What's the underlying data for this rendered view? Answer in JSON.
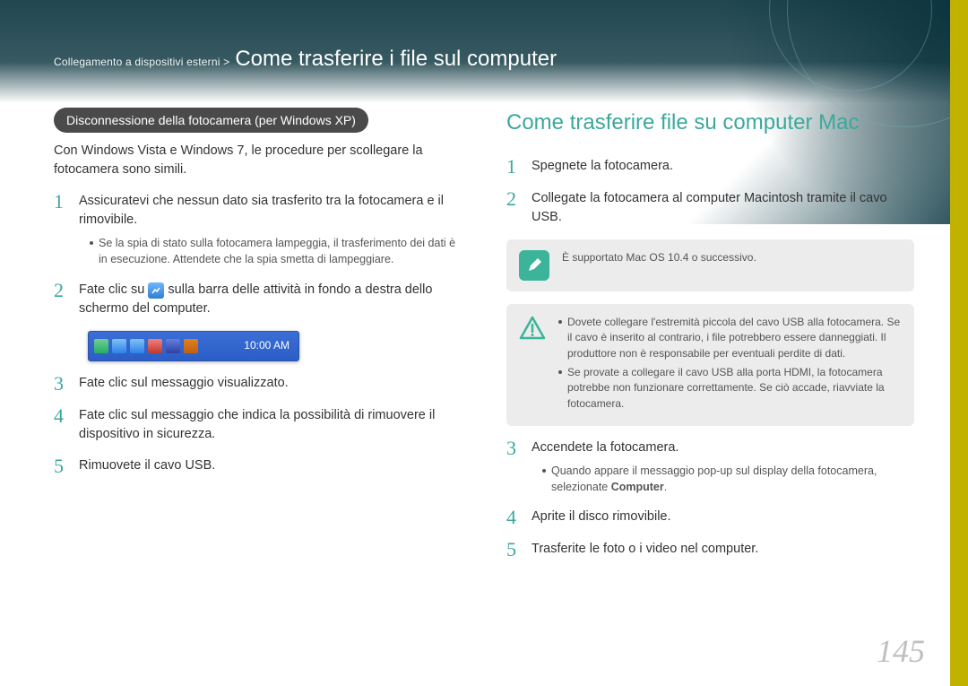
{
  "header": {
    "breadcrumb": "Collegamento a dispositivi esterni >",
    "title": "Come trasferire i file sul computer"
  },
  "left": {
    "pill": "Disconnessione della fotocamera (per Windows XP)",
    "intro": "Con Windows Vista e Windows 7, le procedure per scollegare la fotocamera sono simili.",
    "step1": "Assicuratevi che nessun dato sia trasferito tra la fotocamera e il rimovibile.",
    "step1_bullet": "Se la spia di stato sulla fotocamera lampeggia, il trasferimento dei dati è in esecuzione. Attendete che la spia smetta di lampeggiare.",
    "step2_a": "Fate clic su",
    "step2_b": "sulla barra delle attività in fondo a destra dello schermo del computer.",
    "taskbar_time": "10:00 AM",
    "step3": "Fate clic sul messaggio visualizzato.",
    "step4": "Fate clic sul messaggio che indica la possibilità di rimuovere il dispositivo in sicurezza.",
    "step5": "Rimuovete il cavo USB."
  },
  "right": {
    "heading": "Come trasferire file su computer Mac",
    "step1": "Spegnete la fotocamera.",
    "step2": "Collegate la fotocamera al computer Macintosh tramite il cavo USB.",
    "note1": "È supportato Mac OS 10.4 o successivo.",
    "warn_items": [
      "Dovete collegare l'estremità piccola del cavo USB alla fotocamera. Se il cavo è inserito al contrario, i file potrebbero essere danneggiati. Il produttore non è responsabile per eventuali perdite di dati.",
      "Se provate a collegare il cavo USB alla porta HDMI, la fotocamera potrebbe non funzionare correttamente. Se ciò accade, riavviate la fotocamera."
    ],
    "step3": "Accendete la fotocamera.",
    "step3_bullet_a": "Quando appare il messaggio pop-up sul display della fotocamera, selezionate ",
    "step3_bullet_bold": "Computer",
    "step3_bullet_b": ".",
    "step4": "Aprite il disco rimovibile.",
    "step5": "Trasferite le foto o i video nel computer."
  },
  "page_number": "145",
  "taskbar_icons": {
    "colors": [
      "#2ecc71",
      "#3aa0e0",
      "#3aa0e0",
      "#d04040",
      "#4060d0",
      "#d04080"
    ]
  }
}
